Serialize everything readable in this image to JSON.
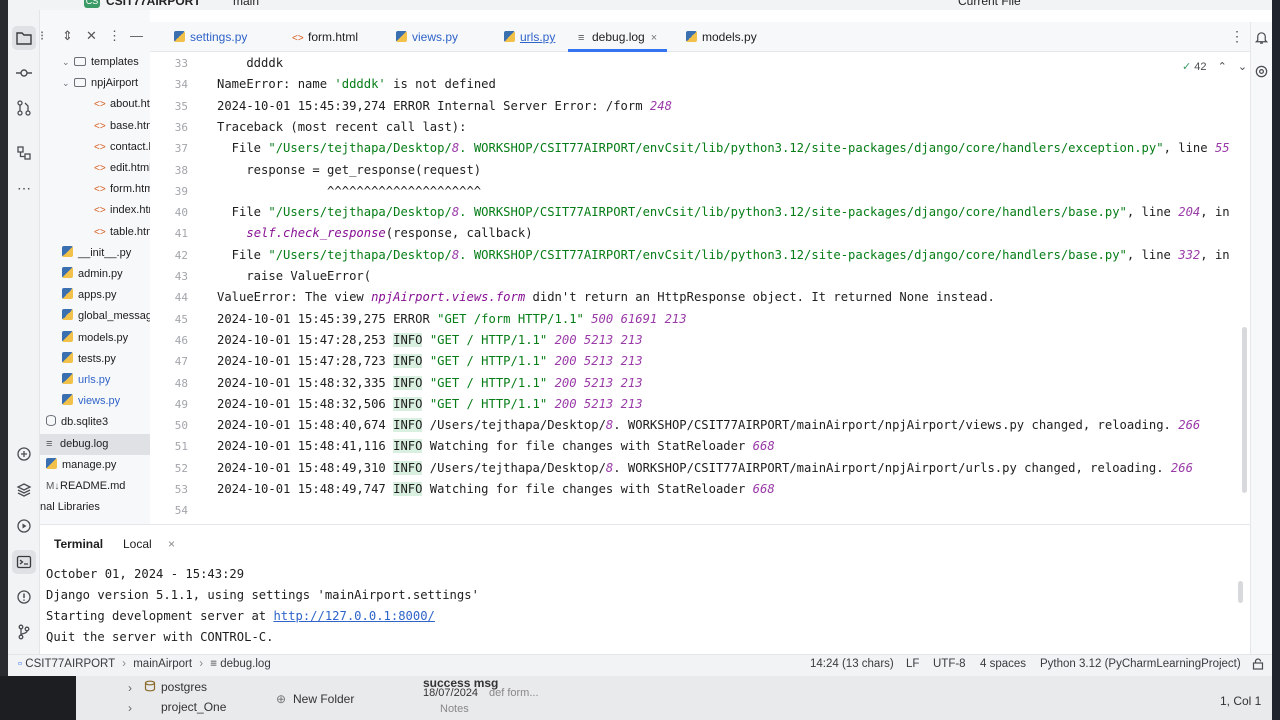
{
  "titlebar": {
    "project_badge": "CS",
    "project": "CSIT77AIRPORT",
    "branch": "main",
    "run_config": "Current File"
  },
  "project_tree": [
    {
      "label": "templates",
      "icon": "folder-icon",
      "depth": 0,
      "chev": "⌄"
    },
    {
      "label": "npjAirport",
      "icon": "folder-icon",
      "depth": 1,
      "chev": "⌄"
    },
    {
      "label": "about.htm",
      "icon": "html-icon",
      "depth": 2
    },
    {
      "label": "base.html",
      "icon": "html-icon",
      "depth": 2
    },
    {
      "label": "contact.h",
      "icon": "html-icon",
      "depth": 2
    },
    {
      "label": "edit.html",
      "icon": "html-icon",
      "depth": 2
    },
    {
      "label": "form.html",
      "icon": "html-icon",
      "depth": 2
    },
    {
      "label": "index.htm",
      "icon": "html-icon",
      "depth": 2
    },
    {
      "label": "table.htm",
      "icon": "html-icon",
      "depth": 2
    },
    {
      "label": "__init__.py",
      "icon": "python-icon",
      "depth": 0
    },
    {
      "label": "admin.py",
      "icon": "python-icon",
      "depth": 0
    },
    {
      "label": "apps.py",
      "icon": "python-icon",
      "depth": 0
    },
    {
      "label": "global_message.",
      "icon": "python-icon",
      "depth": 0
    },
    {
      "label": "models.py",
      "icon": "python-icon",
      "depth": 0
    },
    {
      "label": "tests.py",
      "icon": "python-icon",
      "depth": 0
    },
    {
      "label": "urls.py",
      "icon": "python-icon",
      "depth": 0,
      "modified": true
    },
    {
      "label": "views.py",
      "icon": "python-icon",
      "depth": 0,
      "modified": true
    },
    {
      "label": "db.sqlite3",
      "icon": "database-icon",
      "depth": -1
    },
    {
      "label": "debug.log",
      "icon": "log-icon",
      "depth": -1,
      "selected": true
    },
    {
      "label": "manage.py",
      "icon": "python-icon",
      "depth": -1
    },
    {
      "label": "README.md",
      "icon": "markdown-icon",
      "depth": -1
    },
    {
      "label": "nal Libraries",
      "icon": "",
      "depth": -2
    }
  ],
  "tabs": [
    {
      "label": "settings.py",
      "icon": "python-icon",
      "modified": true
    },
    {
      "label": "form.html",
      "icon": "html-icon"
    },
    {
      "label": "views.py",
      "icon": "python-icon",
      "modified": true
    },
    {
      "label": "urls.py",
      "icon": "python-icon",
      "modified": true,
      "underlined": true
    },
    {
      "label": "debug.log",
      "icon": "log-icon",
      "active": true,
      "close": "×"
    },
    {
      "label": "models.py",
      "icon": "python-icon"
    }
  ],
  "inspections": {
    "count": "42",
    "up": "⌃",
    "down": "⌄"
  },
  "code_lines": [
    {
      "n": "33",
      "text": "    ddddk"
    },
    {
      "n": "34",
      "text": "NameError: name 'ddddk' is not defined"
    },
    {
      "n": "35",
      "text": "2024-10-01 15:45:39,274 ERROR Internal Server Error: /form 248"
    },
    {
      "n": "36",
      "text": "Traceback (most recent call last):"
    },
    {
      "n": "37",
      "text": "  File \"/Users/tejthapa/Desktop/8. WORKSHOP/CSIT77AIRPORT/envCsit/lib/python3.12/site-packages/django/core/handlers/exception.py\", line 55"
    },
    {
      "n": "38",
      "text": "    response = get_response(request)"
    },
    {
      "n": "39",
      "text": "               ^^^^^^^^^^^^^^^^^^^^^"
    },
    {
      "n": "40",
      "text": "  File \"/Users/tejthapa/Desktop/8. WORKSHOP/CSIT77AIRPORT/envCsit/lib/python3.12/site-packages/django/core/handlers/base.py\", line 204, in"
    },
    {
      "n": "41",
      "text": "    self.check_response(response, callback)"
    },
    {
      "n": "42",
      "text": "  File \"/Users/tejthapa/Desktop/8. WORKSHOP/CSIT77AIRPORT/envCsit/lib/python3.12/site-packages/django/core/handlers/base.py\", line 332, in"
    },
    {
      "n": "43",
      "text": "    raise ValueError("
    },
    {
      "n": "44",
      "text": "ValueError: The view npjAirport.views.form didn't return an HttpResponse object. It returned None instead."
    },
    {
      "n": "45",
      "text": "2024-10-01 15:45:39,275 ERROR \"GET /form HTTP/1.1\" 500 61691 213"
    },
    {
      "n": "46",
      "text": "2024-10-01 15:47:28,253 INFO \"GET / HTTP/1.1\" 200 5213 213"
    },
    {
      "n": "47",
      "text": "2024-10-01 15:47:28,723 INFO \"GET / HTTP/1.1\" 200 5213 213"
    },
    {
      "n": "48",
      "text": "2024-10-01 15:48:32,335 INFO \"GET / HTTP/1.1\" 200 5213 213"
    },
    {
      "n": "49",
      "text": "2024-10-01 15:48:32,506 INFO \"GET / HTTP/1.1\" 200 5213 213"
    },
    {
      "n": "50",
      "text": "2024-10-01 15:48:40,674 INFO /Users/tejthapa/Desktop/8. WORKSHOP/CSIT77AIRPORT/mainAirport/npjAirport/views.py changed, reloading. 266"
    },
    {
      "n": "51",
      "text": "2024-10-01 15:48:41,116 INFO Watching for file changes with StatReloader 668"
    },
    {
      "n": "52",
      "text": "2024-10-01 15:48:49,310 INFO /Users/tejthapa/Desktop/8. WORKSHOP/CSIT77AIRPORT/mainAirport/npjAirport/urls.py changed, reloading. 266"
    },
    {
      "n": "53",
      "text": "2024-10-01 15:48:49,747 INFO Watching for file changes with StatReloader 668"
    },
    {
      "n": "54",
      "text": ""
    }
  ],
  "terminal": {
    "tab_terminal": "Terminal",
    "tab_local": "Local",
    "tab_local_close": "×",
    "lines": [
      "October 01, 2024 - 15:43:29",
      "Django version 5.1.1, using settings 'mainAirport.settings'",
      "Starting development server at ",
      "Quit the server with CONTROL-C."
    ],
    "server_url": "http://127.0.0.1:8000/"
  },
  "statusbar": {
    "crumb_project": "CSIT77AIRPORT",
    "crumb_folder": "mainAirport",
    "crumb_file": "debug.log",
    "position": "14:24 (13 chars)",
    "line_sep": "LF",
    "encoding": "UTF-8",
    "indent": "4 spaces",
    "interpreter": "Python 3.12 (PyCharmLearningProject)"
  },
  "background_window": {
    "postgres": "postgres",
    "project_one": "project_One",
    "new_folder": "New Folder",
    "note_title": "success msg",
    "note_date": "18/07/2024",
    "note_preview": "def form...",
    "notes": "Notes",
    "cursor_pos": "1, Col 1"
  },
  "colors": {
    "accent": "#3574f0",
    "string": "#067d17",
    "number": "#9a3aa8",
    "info_bg": "#d9efe0"
  }
}
